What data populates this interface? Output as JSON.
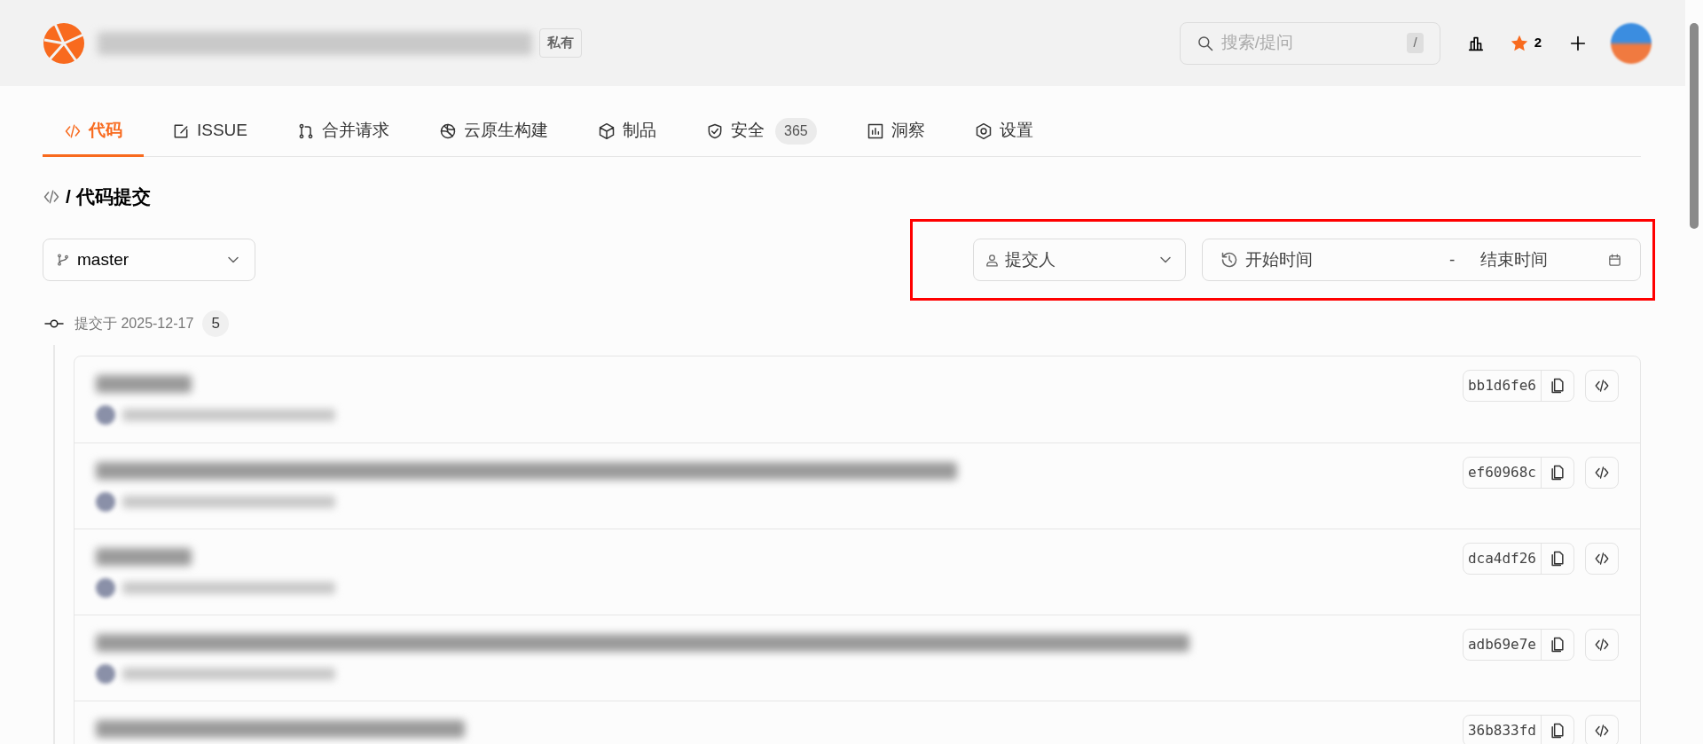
{
  "header": {
    "visibility_badge": "私有",
    "search": {
      "placeholder": "搜索/提问",
      "shortcut": "/"
    },
    "star_count": "2"
  },
  "tabs": [
    {
      "label": "代码",
      "selected": true
    },
    {
      "label": "ISSUE",
      "selected": false
    },
    {
      "label": "合并请求",
      "selected": false
    },
    {
      "label": "云原生构建",
      "selected": false
    },
    {
      "label": "制品",
      "selected": false
    },
    {
      "label": "安全",
      "selected": false,
      "count": "365"
    },
    {
      "label": "洞察",
      "selected": false
    },
    {
      "label": "设置",
      "selected": false
    }
  ],
  "breadcrumb": {
    "separator": "/",
    "title": "代码提交"
  },
  "branch_select": {
    "value": "master"
  },
  "filters": {
    "committer": {
      "placeholder": "提交人"
    },
    "date_range": {
      "start_placeholder": "开始时间",
      "separator": "-",
      "end_placeholder": "结束时间"
    },
    "highlighted": true
  },
  "commit_group": {
    "label": "提交于 2025-12-17",
    "count": "5",
    "commits": [
      {
        "hash": "bb1d6fe6"
      },
      {
        "hash": "ef60968c"
      },
      {
        "hash": "dca4df26"
      },
      {
        "hash": "adb69e7e"
      },
      {
        "hash": "36b833fd"
      }
    ]
  }
}
